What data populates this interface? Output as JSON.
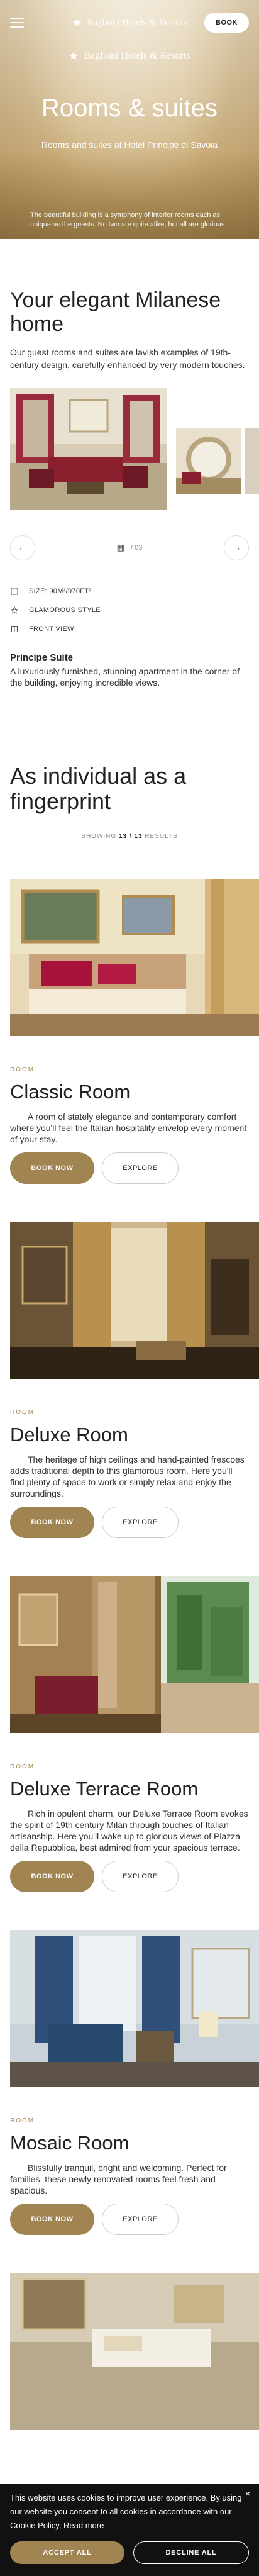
{
  "header": {
    "brand": "Baglioni Hotels & Resorts",
    "hero_brand": "Baglioni Hotels & Resorts",
    "book_label": "BOOK"
  },
  "hero": {
    "title": "Rooms & suites",
    "subtitle": "Rooms and suites at Hotel Principe di Savoia",
    "description": "The beautiful building is a symphony of interior rooms each as unique as the guests. No two are quite alike, but all are glorious."
  },
  "intro": {
    "heading": "Your elegant Milanese home",
    "text": "Our guest rooms and suites are lavish examples of 19th-century design, carefully enhanced by very modern touches."
  },
  "gallery": {
    "counter": "/ 03",
    "prev_label": "←",
    "next_label": "→"
  },
  "features": [
    {
      "icon": "size-icon",
      "label": "SIZE: 90M²/970FT²"
    },
    {
      "icon": "style-icon",
      "label": "GLAMOROUS STYLE"
    },
    {
      "icon": "view-icon",
      "label": "FRONT VIEW"
    }
  ],
  "suite": {
    "name": "Principe Suite",
    "text": "A luxuriously furnished, stunning apartment in the corner of the building, enjoying incredible views."
  },
  "fingerprint": {
    "heading": "As individual as a fingerprint",
    "showing_label": "SHOWING",
    "showing_value": "13 / 13",
    "results_label": "RESULTS"
  },
  "rooms": [
    {
      "tag": "ROOM",
      "title": "Classic Room",
      "text": "A room of stately elegance and contemporary comfort where you'll feel the Italian hospitality envelop every moment of your stay.",
      "book": "BOOK NOW",
      "explore": "EXPLORE"
    },
    {
      "tag": "ROOM",
      "title": "Deluxe Room",
      "text": "The heritage of high ceilings and hand-painted frescoes adds traditional depth to this glamorous room. Here you'll find plenty of space to work or simply relax and enjoy the surroundings.",
      "book": "BOOK NOW",
      "explore": "EXPLORE"
    },
    {
      "tag": "ROOM",
      "title": "Deluxe Terrace Room",
      "text": "Rich in opulent charm, our Deluxe Terrace Room evokes the spirit of 19th century Milan through touches of Italian artisanship. Here you'll wake up to glorious views of Piazza della Repubblica, best admired from your spacious terrace.",
      "book": "BOOK NOW",
      "explore": "EXPLORE"
    },
    {
      "tag": "ROOM",
      "title": "Mosaic Room",
      "text": "Blissfully tranquil, bright and welcoming. Perfect for families, these newly renovated rooms feel fresh and spacious.",
      "book": "BOOK NOW",
      "explore": "EXPLORE"
    }
  ],
  "cookie": {
    "text": "This website uses cookies to improve user experience. By using our website you consent to all cookies in accordance with our Cookie Policy.",
    "read_more": "Read more",
    "accept": "ACCEPT ALL",
    "decline": "DECLINE ALL",
    "close": "×"
  },
  "colors": {
    "accent": "#a08552",
    "dark": "#111111"
  }
}
